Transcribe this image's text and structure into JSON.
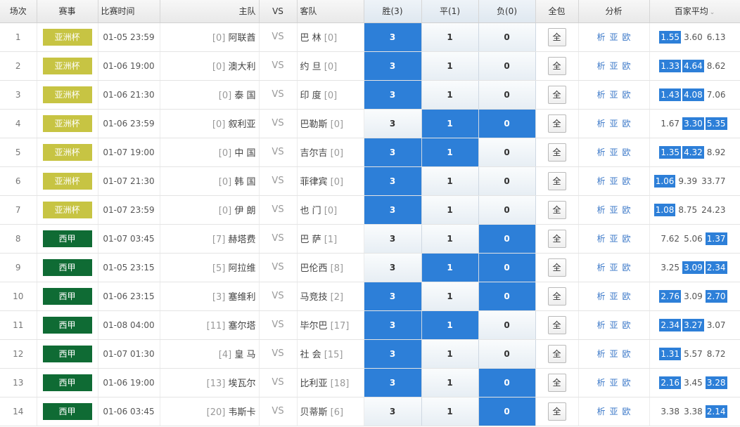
{
  "colors": {
    "asia_cup": "#c7c443",
    "la_liga": "#0f6b34",
    "selected": "#2d7fd8"
  },
  "header": {
    "no": "场次",
    "league": "赛事",
    "time": "比赛时间",
    "home": "主队",
    "vs": "VS",
    "away": "客队",
    "win": "胜(3)",
    "draw": "平(1)",
    "lose": "负(0)",
    "all": "全包",
    "analysis": "分析",
    "odds": "百家平均",
    "odds_caret": "chevron-down-icon"
  },
  "labels": {
    "vs": "VS",
    "all_button": "全",
    "analysis": [
      "析",
      "亚",
      "欧"
    ],
    "win": "3",
    "draw": "1",
    "lose": "0"
  },
  "rows": [
    {
      "no": "1",
      "league": "亚洲杯",
      "league_type": "asia",
      "time": "01-05 23:59",
      "home_rank": "[0]",
      "home": "阿联酋",
      "away": "巴 林",
      "away_rank": "[0]",
      "picks": [
        true,
        false,
        false
      ],
      "odds": [
        "1.55",
        "3.60",
        "6.13"
      ],
      "hl": [
        true,
        false,
        false
      ]
    },
    {
      "no": "2",
      "league": "亚洲杯",
      "league_type": "asia",
      "time": "01-06 19:00",
      "home_rank": "[0]",
      "home": "澳大利",
      "away": "约 旦",
      "away_rank": "[0]",
      "picks": [
        true,
        false,
        false
      ],
      "odds": [
        "1.33",
        "4.64",
        "8.62"
      ],
      "hl": [
        true,
        true,
        false
      ]
    },
    {
      "no": "3",
      "league": "亚洲杯",
      "league_type": "asia",
      "time": "01-06 21:30",
      "home_rank": "[0]",
      "home": "泰 国",
      "away": "印 度",
      "away_rank": "[0]",
      "picks": [
        true,
        false,
        false
      ],
      "odds": [
        "1.43",
        "4.08",
        "7.06"
      ],
      "hl": [
        true,
        true,
        false
      ]
    },
    {
      "no": "4",
      "league": "亚洲杯",
      "league_type": "asia",
      "time": "01-06 23:59",
      "home_rank": "[0]",
      "home": "叙利亚",
      "away": "巴勒斯",
      "away_rank": "[0]",
      "picks": [
        false,
        true,
        true
      ],
      "odds": [
        "1.67",
        "3.30",
        "5.35"
      ],
      "hl": [
        false,
        true,
        true
      ]
    },
    {
      "no": "5",
      "league": "亚洲杯",
      "league_type": "asia",
      "time": "01-07 19:00",
      "home_rank": "[0]",
      "home": "中 国",
      "away": "吉尔吉",
      "away_rank": "[0]",
      "picks": [
        true,
        true,
        false
      ],
      "odds": [
        "1.35",
        "4.32",
        "8.92"
      ],
      "hl": [
        true,
        true,
        false
      ]
    },
    {
      "no": "6",
      "league": "亚洲杯",
      "league_type": "asia",
      "time": "01-07 21:30",
      "home_rank": "[0]",
      "home": "韩 国",
      "away": "菲律宾",
      "away_rank": "[0]",
      "picks": [
        true,
        false,
        false
      ],
      "odds": [
        "1.06",
        "9.39",
        "33.77"
      ],
      "hl": [
        true,
        false,
        false
      ]
    },
    {
      "no": "7",
      "league": "亚洲杯",
      "league_type": "asia",
      "time": "01-07 23:59",
      "home_rank": "[0]",
      "home": "伊 朗",
      "away": "也 门",
      "away_rank": "[0]",
      "picks": [
        true,
        false,
        false
      ],
      "odds": [
        "1.08",
        "8.75",
        "24.23"
      ],
      "hl": [
        true,
        false,
        false
      ]
    },
    {
      "no": "8",
      "league": "西甲",
      "league_type": "liga",
      "time": "01-07 03:45",
      "home_rank": "[7]",
      "home": "赫塔费",
      "away": "巴 萨",
      "away_rank": "[1]",
      "picks": [
        false,
        false,
        true
      ],
      "odds": [
        "7.62",
        "5.06",
        "1.37"
      ],
      "hl": [
        false,
        false,
        true
      ]
    },
    {
      "no": "9",
      "league": "西甲",
      "league_type": "liga",
      "time": "01-05 23:15",
      "home_rank": "[5]",
      "home": "阿拉维",
      "away": "巴伦西",
      "away_rank": "[8]",
      "picks": [
        false,
        true,
        true
      ],
      "odds": [
        "3.25",
        "3.09",
        "2.34"
      ],
      "hl": [
        false,
        true,
        true
      ]
    },
    {
      "no": "10",
      "league": "西甲",
      "league_type": "liga",
      "time": "01-06 23:15",
      "home_rank": "[3]",
      "home": "塞维利",
      "away": "马竞技",
      "away_rank": "[2]",
      "picks": [
        true,
        false,
        true
      ],
      "odds": [
        "2.76",
        "3.09",
        "2.70"
      ],
      "hl": [
        true,
        false,
        true
      ]
    },
    {
      "no": "11",
      "league": "西甲",
      "league_type": "liga",
      "time": "01-08 04:00",
      "home_rank": "[11]",
      "home": "塞尔塔",
      "away": "毕尔巴",
      "away_rank": "[17]",
      "picks": [
        true,
        true,
        false
      ],
      "odds": [
        "2.34",
        "3.27",
        "3.07"
      ],
      "hl": [
        true,
        true,
        false
      ]
    },
    {
      "no": "12",
      "league": "西甲",
      "league_type": "liga",
      "time": "01-07 01:30",
      "home_rank": "[4]",
      "home": "皇 马",
      "away": "社 会",
      "away_rank": "[15]",
      "picks": [
        true,
        false,
        false
      ],
      "odds": [
        "1.31",
        "5.57",
        "8.72"
      ],
      "hl": [
        true,
        false,
        false
      ]
    },
    {
      "no": "13",
      "league": "西甲",
      "league_type": "liga",
      "time": "01-06 19:00",
      "home_rank": "[13]",
      "home": "埃瓦尔",
      "away": "比利亚",
      "away_rank": "[18]",
      "picks": [
        true,
        false,
        true
      ],
      "odds": [
        "2.16",
        "3.45",
        "3.28"
      ],
      "hl": [
        true,
        false,
        true
      ]
    },
    {
      "no": "14",
      "league": "西甲",
      "league_type": "liga",
      "time": "01-06 03:45",
      "home_rank": "[20]",
      "home": "韦斯卡",
      "away": "贝蒂斯",
      "away_rank": "[6]",
      "picks": [
        false,
        false,
        true
      ],
      "odds": [
        "3.38",
        "3.38",
        "2.14"
      ],
      "hl": [
        false,
        false,
        true
      ]
    }
  ]
}
